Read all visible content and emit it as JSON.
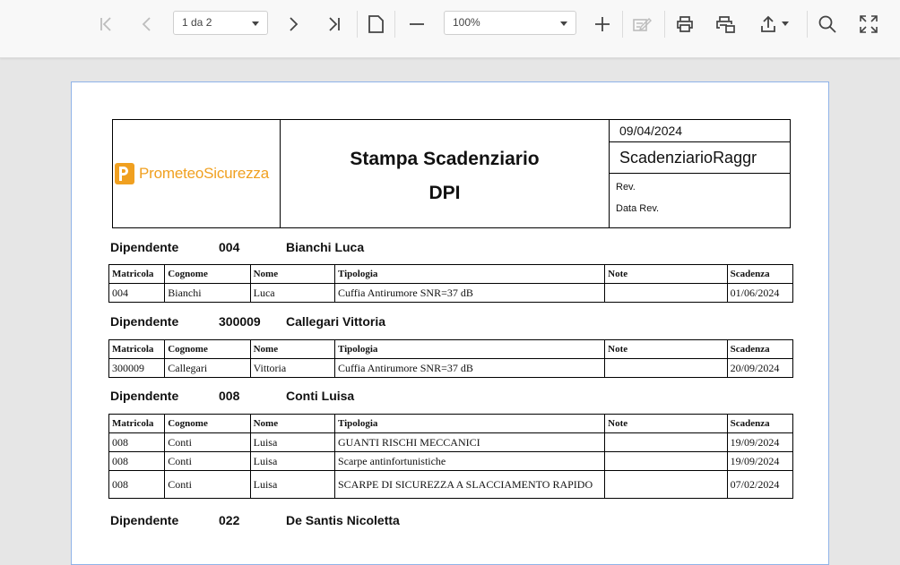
{
  "toolbar": {
    "page_select": "1 da 2",
    "zoom_select": "100%",
    "icons": [
      "first-page-icon",
      "prev-page-icon",
      "next-page-icon",
      "last-page-icon",
      "single-page-icon",
      "zoom-out-icon",
      "zoom-in-icon",
      "edit-form-icon",
      "print-icon",
      "print-page-icon",
      "export-icon",
      "search-icon",
      "fullscreen-icon"
    ]
  },
  "report": {
    "logo_text": "PrometeoSicurezza",
    "title_line1": "Stampa Scadenziario",
    "title_line2": "DPI",
    "date": "09/04/2024",
    "code": "ScadenziarioRaggr",
    "rev_label": "Rev.",
    "data_rev_label": "Data Rev."
  },
  "columns": [
    "Matricola",
    "Cognome",
    "Nome",
    "Tipologia",
    "Note",
    "Scadenza"
  ],
  "employees": [
    {
      "label": "Dipendente",
      "id": "004",
      "name": "Bianchi Luca",
      "rows": [
        [
          "004",
          "Bianchi",
          "Luca",
          "Cuffia Antirumore SNR=37 dB",
          "",
          "01/06/2024"
        ]
      ]
    },
    {
      "label": "Dipendente",
      "id": "300009",
      "name": "Callegari Vittoria",
      "rows": [
        [
          "300009",
          "Callegari",
          "Vittoria",
          "Cuffia Antirumore SNR=37 dB",
          "",
          "20/09/2024"
        ]
      ]
    },
    {
      "label": "Dipendente",
      "id": "008",
      "name": "Conti Luisa",
      "rows": [
        [
          "008",
          "Conti",
          "Luisa",
          "GUANTI RISCHI MECCANICI",
          "",
          "19/09/2024"
        ],
        [
          "008",
          "Conti",
          "Luisa",
          "Scarpe antinfortunistiche",
          "",
          "19/09/2024"
        ],
        [
          "008",
          "Conti",
          "Luisa",
          "SCARPE DI SICUREZZA A SLACCIAMENTO RAPIDO",
          "",
          "07/02/2024"
        ]
      ]
    },
    {
      "label": "Dipendente",
      "id": "022",
      "name": "De Santis Nicoletta",
      "rows": []
    }
  ]
}
